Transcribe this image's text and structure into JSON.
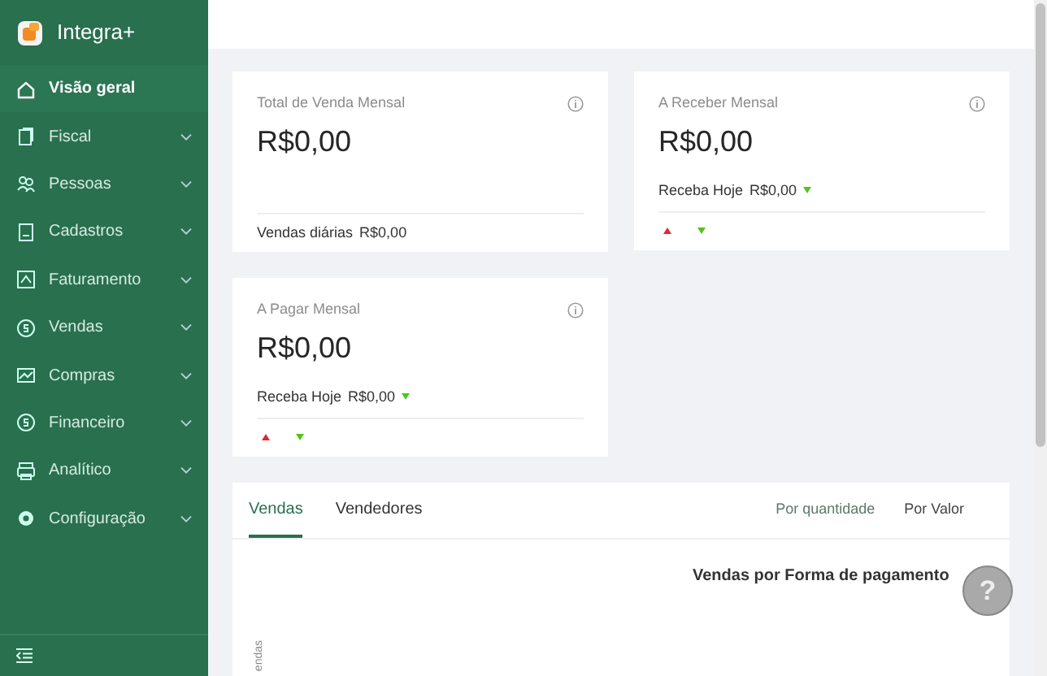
{
  "sidebar": {
    "brand": "Integra+",
    "items": [
      {
        "label": "Visão geral",
        "selected": true,
        "expandable": false
      },
      {
        "label": "Fiscal",
        "selected": false,
        "expandable": true
      },
      {
        "label": "Pessoas",
        "selected": false,
        "expandable": true
      },
      {
        "label": "Cadastros",
        "selected": false,
        "expandable": true
      },
      {
        "label": "Faturamento",
        "selected": false,
        "expandable": true
      },
      {
        "label": "Vendas",
        "selected": false,
        "expandable": true
      },
      {
        "label": "Compras",
        "selected": false,
        "expandable": true
      },
      {
        "label": "Financeiro",
        "selected": false,
        "expandable": true
      },
      {
        "label": "Analítico",
        "selected": false,
        "expandable": true
      },
      {
        "label": "Configuração",
        "selected": false,
        "expandable": true
      }
    ]
  },
  "cards": [
    {
      "kind": "daily",
      "title": "Total de Venda Mensal",
      "value": "R$0,00",
      "footer_label": "Vendas diárias",
      "footer_value": "R$0,00"
    },
    {
      "kind": "receivable",
      "title": "A Receber Mensal",
      "value": "R$0,00",
      "footer_label": "Receba Hoje",
      "footer_value": "R$0,00"
    },
    {
      "kind": "receivable",
      "title": "A Pagar Mensal",
      "value": "R$0,00",
      "footer_label": "Receba Hoje",
      "footer_value": "R$0,00"
    }
  ],
  "sales_panel": {
    "tabs": [
      {
        "label": "Vendas",
        "selected": true
      },
      {
        "label": "Vendedores",
        "selected": false
      }
    ],
    "modes": [
      {
        "label": "Por quantidade",
        "selected": true
      },
      {
        "label": "Por Valor",
        "selected": false
      }
    ],
    "chart_title": "Vendas por Forma de pagamento",
    "y_axis_label": "endas"
  },
  "help_button": {
    "label": "?"
  }
}
